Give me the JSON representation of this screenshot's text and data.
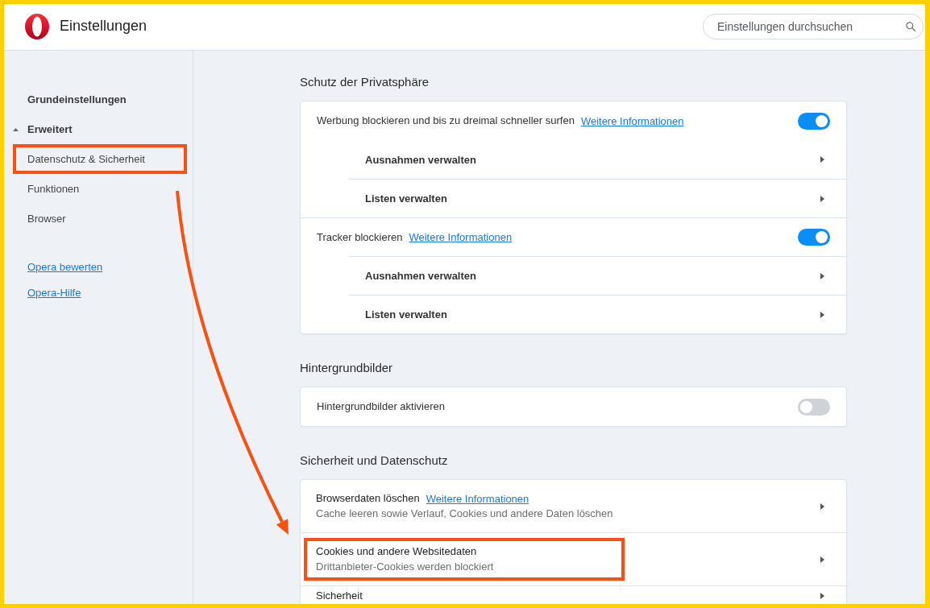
{
  "header": {
    "title": "Einstellungen",
    "search": {
      "placeholder": "Einstellungen durchsuchen"
    }
  },
  "sidebar": {
    "items": [
      {
        "kind": "heading",
        "label": "Grundeinstellungen",
        "highlighted": false
      },
      {
        "kind": "group",
        "label": "Erweitert",
        "expanded": true,
        "highlighted": false
      },
      {
        "kind": "item",
        "label": "Datenschutz & Sicherheit",
        "highlighted": true
      },
      {
        "kind": "item",
        "label": "Funktionen",
        "highlighted": false
      },
      {
        "kind": "item",
        "label": "Browser",
        "highlighted": false
      }
    ],
    "links": [
      {
        "label": "Opera bewerten"
      },
      {
        "label": "Opera-Hilfe"
      }
    ]
  },
  "sections": [
    {
      "title": "Schutz der Privatsphäre",
      "rows": [
        {
          "kind": "toggle",
          "label": "Werbung blockieren und bis zu dreimal schneller surfen",
          "link": "Weitere Informationen",
          "on": true,
          "highlighted": false
        },
        {
          "kind": "subpage",
          "label": "Ausnahmen verwalten",
          "highlighted": false
        },
        {
          "kind": "subpage",
          "label": "Listen verwalten",
          "highlighted": false
        },
        {
          "kind": "toggle",
          "label": "Tracker blockieren",
          "link": "Weitere Informationen",
          "on": true,
          "highlighted": false
        },
        {
          "kind": "subpage",
          "label": "Ausnahmen verwalten",
          "highlighted": false
        },
        {
          "kind": "subpage",
          "label": "Listen verwalten",
          "highlighted": false
        }
      ]
    },
    {
      "title": "Hintergrundbilder",
      "rows": [
        {
          "kind": "toggle",
          "label": "Hintergrundbilder aktivieren",
          "on": false,
          "highlighted": false
        }
      ]
    },
    {
      "title": "Sicherheit und Datenschutz",
      "rows": [
        {
          "kind": "page",
          "label": "Browserdaten löschen",
          "link": "Weitere Informationen",
          "description": "Cache leeren sowie Verlauf, Cookies und andere Daten löschen",
          "highlighted": false
        },
        {
          "kind": "page",
          "label": "Cookies und andere Websitedaten",
          "description": "Drittanbieter-Cookies werden blockiert",
          "highlighted": true
        },
        {
          "kind": "page",
          "label": "Sicherheit",
          "highlighted": false
        }
      ]
    }
  ]
}
